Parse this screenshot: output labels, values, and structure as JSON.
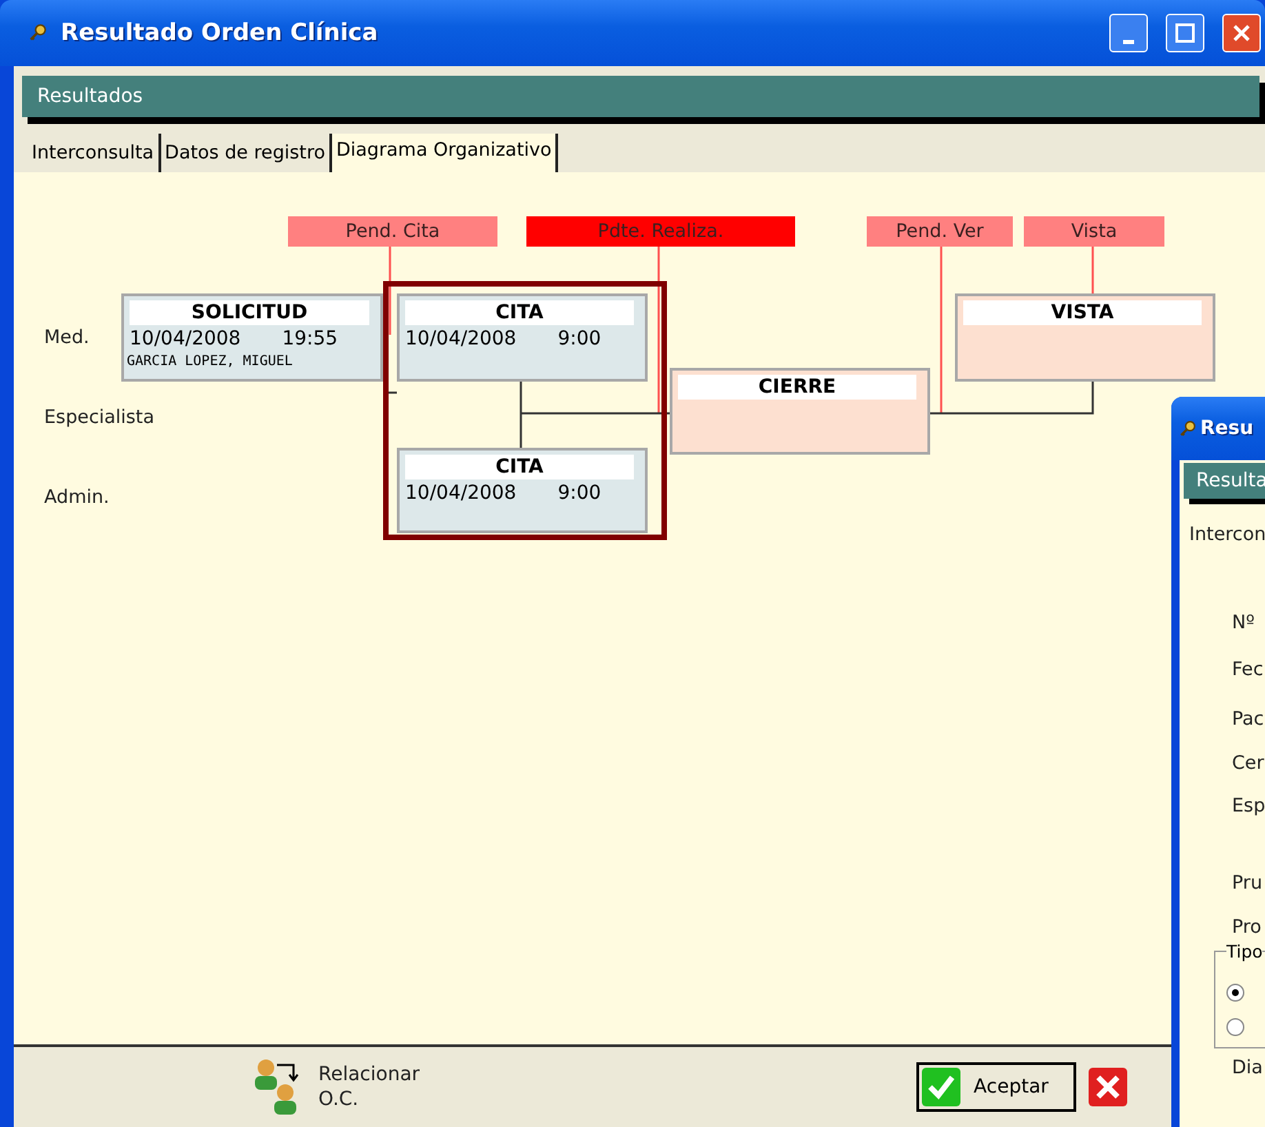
{
  "window": {
    "title": "Resultado Orden Clínica"
  },
  "header": {
    "title": "Resultados"
  },
  "tabs": [
    {
      "label": "Interconsulta",
      "selected": false
    },
    {
      "label": "Datos de registro",
      "selected": false
    },
    {
      "label": "Diagrama Organizativo",
      "selected": true
    }
  ],
  "diagram": {
    "rows": [
      "Med.",
      "Especialista",
      "Admin."
    ],
    "statuses": [
      {
        "label": "Pend. Cita",
        "color": "#ff8080"
      },
      {
        "label": "Pdte. Realiza.",
        "color": "#ff0000"
      },
      {
        "label": "Pend. Ver",
        "color": "#ff8080"
      },
      {
        "label": "Vista",
        "color": "#ff8080"
      }
    ],
    "nodes": [
      {
        "title": "SOLICITUD",
        "date": "10/04/2008",
        "time": "19:55",
        "person": "GARCIA LOPEZ, MIGUEL",
        "color": "#dde8ea",
        "selected": false
      },
      {
        "title": "CITA",
        "date": "10/04/2008",
        "time": "9:00",
        "color": "#dde8ea",
        "selected": true
      },
      {
        "title": "CITA",
        "date": "10/04/2008",
        "time": "9:00",
        "color": "#dde8ea",
        "selected": true
      },
      {
        "title": "CIERRE",
        "color": "#fde0d0",
        "selected": false
      },
      {
        "title": "VISTA",
        "color": "#fde0d0",
        "selected": false
      }
    ]
  },
  "footer": {
    "buttons": [
      {
        "kind": "relate",
        "lines": [
          "Relacionar",
          "O.C."
        ]
      },
      {
        "kind": "accept",
        "label": "Aceptar"
      },
      {
        "kind": "cancel"
      }
    ]
  },
  "second_window": {
    "title": "Resu",
    "header": "Resulta",
    "tab": "Intercon",
    "fields": [
      "Nº",
      "Fec",
      "Pac",
      "Cer",
      "Esp",
      "Pru",
      "Pro"
    ],
    "group": {
      "title": "Tipo",
      "options": [
        {
          "selected": true
        },
        {
          "selected": false
        }
      ]
    },
    "last_field": "Dia"
  }
}
